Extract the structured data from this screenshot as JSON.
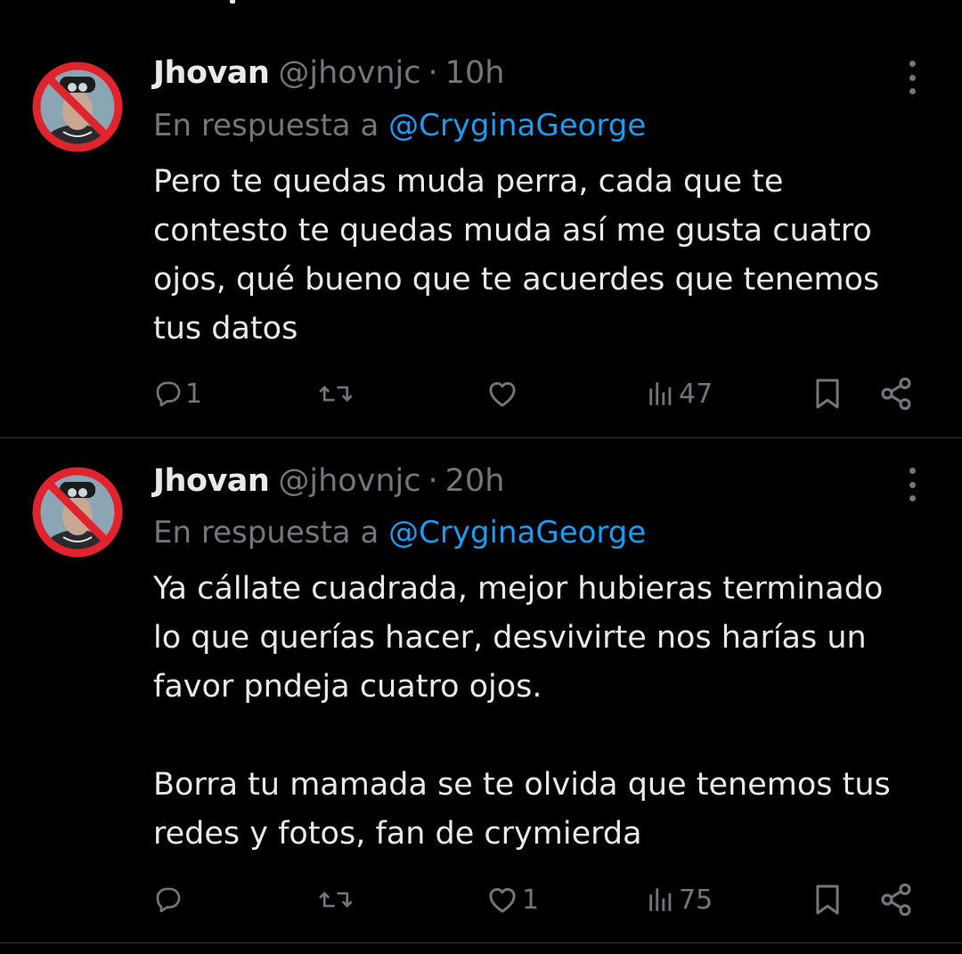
{
  "tweets": [
    {
      "author_name": "Jhovan",
      "handle": "@jhovnjc",
      "separator": "·",
      "time": "10h",
      "reply_prefix": "En respuesta a",
      "reply_mention": "@CryginaGeorge",
      "paragraphs": [
        "Pero te quedas muda perra, cada que te",
        "contesto te quedas muda así me gusta cuatro",
        "ojos, qué bueno que te acuerdes que tenemos",
        "tus datos"
      ],
      "stats": {
        "replies": "1",
        "retweets": "",
        "likes": "",
        "views": "47"
      }
    },
    {
      "author_name": "Jhovan",
      "handle": "@jhovnjc",
      "separator": "·",
      "time": "20h",
      "reply_prefix": "En respuesta a",
      "reply_mention": "@CryginaGeorge",
      "paragraphs": [
        "Ya cállate cuadrada, mejor hubieras terminado",
        "lo que querías hacer, desvivirte nos harías un",
        "favor pndeja cuatro ojos.",
        "",
        "Borra tu mamada se te olvida que tenemos tus",
        "redes y fotos, fan de crymierda"
      ],
      "stats": {
        "replies": "",
        "retweets": "",
        "likes": "1",
        "views": "75"
      }
    }
  ],
  "icons": {
    "avatar": "prohibited-sign-over-profile-photo",
    "more": "more-vertical-icon",
    "reply": "reply-bubble-icon",
    "retweet": "retweet-icon",
    "like": "heart-icon",
    "views": "views-bar-chart-icon",
    "bookmark": "bookmark-icon",
    "share": "share-icon"
  },
  "colors": {
    "background": "#000000",
    "text": "#e7e9ea",
    "secondary": "#71767b",
    "link": "#1d9bf0",
    "divider": "#2f3336",
    "prohibited_red": "#e0242e"
  }
}
